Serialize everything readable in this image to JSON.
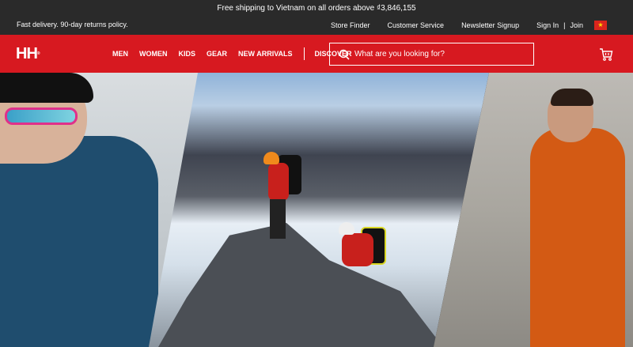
{
  "promo": {
    "text": "Free shipping to Vietnam on all orders above ₫3,846,155"
  },
  "utility": {
    "left_text": "Fast delivery. 90-day returns policy.",
    "links": [
      "Store Finder",
      "Customer Service",
      "Newsletter Signup"
    ],
    "sign_in": "Sign In",
    "separator": "|",
    "join": "Join",
    "flag_icon": "vietnam-flag-icon"
  },
  "nav": {
    "logo": "HH",
    "items": [
      "MEN",
      "WOMEN",
      "KIDS",
      "GEAR",
      "NEW ARRIVALS"
    ],
    "discover": "DISCOVER",
    "search_placeholder": "What are you looking for?",
    "search_icon": "search-icon",
    "cart_icon": "cart-icon"
  },
  "colors": {
    "brand_red": "#d71920",
    "top_bar": "#2a2a2a",
    "text_white": "#ffffff"
  }
}
